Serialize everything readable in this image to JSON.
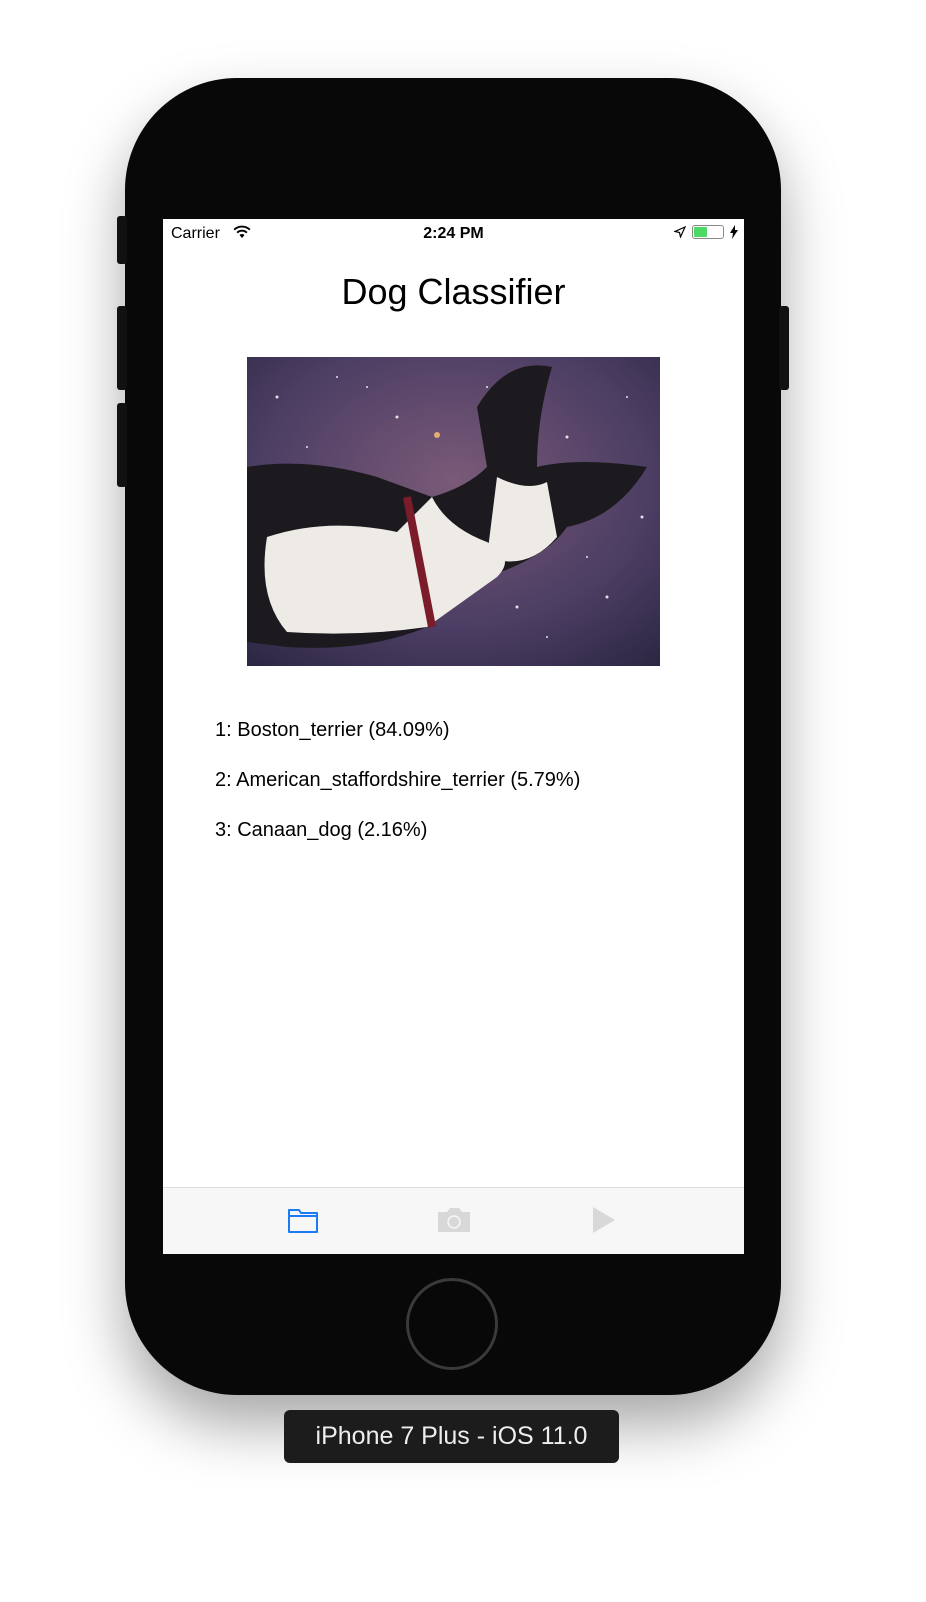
{
  "status": {
    "carrier": "Carrier",
    "time": "2:24 PM"
  },
  "app": {
    "title": "Dog Classifier"
  },
  "results": [
    "1: Boston_terrier (84.09%)",
    "2: American_staffordshire_terrier (5.79%)",
    "3: Canaan_dog (2.16%)"
  ],
  "tabbar": {
    "active_color": "#1a7cf5",
    "inactive_color": "#d8d8d8",
    "icons": [
      "folder-icon",
      "camera-icon",
      "play-icon"
    ]
  },
  "device_label": "iPhone 7 Plus - iOS 11.0"
}
